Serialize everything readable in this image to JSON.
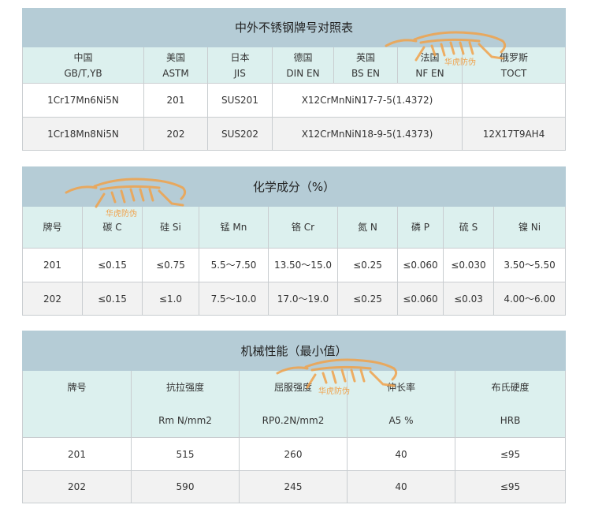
{
  "table1": {
    "title": "中外不锈钢牌号对照表",
    "headers": [
      {
        "line1": "中国",
        "line2": "GB/T,YB"
      },
      {
        "line1": "美国",
        "line2": "ASTM"
      },
      {
        "line1": "日本",
        "line2": "JIS"
      },
      {
        "line1": "德国",
        "line2": "DIN EN"
      },
      {
        "line1": "英国",
        "line2": "BS EN"
      },
      {
        "line1": "法国",
        "line2": "NF EN"
      },
      {
        "line1": "俄罗斯",
        "line2": "TOCT"
      }
    ],
    "rows": [
      {
        "cn": "1Cr17Mn6Ni5N",
        "us": "201",
        "jp": "SUS201",
        "eu": "X12CrMnNiN17-7-5(1.4372)",
        "ru": ""
      },
      {
        "cn": "1Cr18Mn8Ni5N",
        "us": "202",
        "jp": "SUS202",
        "eu": "X12CrMnNiN18-9-5(1.4373)",
        "ru": "12X17T9AH4"
      }
    ]
  },
  "table2": {
    "title": "化学成分（%）",
    "headers": [
      "牌号",
      "碳 C",
      "硅 Si",
      "锰 Mn",
      "铬 Cr",
      "氮 N",
      "磷 P",
      "硫 S",
      "镍 Ni"
    ],
    "rows": [
      [
        "201",
        "≤0.15",
        "≤0.75",
        "5.5～7.50",
        "13.50～15.0",
        "≤0.25",
        "≤0.060",
        "≤0.030",
        "3.50～5.50"
      ],
      [
        "202",
        "≤0.15",
        "≤1.0",
        "7.5～10.0",
        "17.0～19.0",
        "≤0.25",
        "≤0.060",
        "≤0.03",
        "4.00～6.00"
      ]
    ]
  },
  "table3": {
    "title": "机械性能（最小值）",
    "headers": [
      {
        "line1": "牌号",
        "line2": ""
      },
      {
        "line1": "抗拉强度",
        "line2": "Rm N/mm2"
      },
      {
        "line1": "屈服强度",
        "line2": "RP0.2N/mm2"
      },
      {
        "line1": "伸长率",
        "line2": "A5 %"
      },
      {
        "line1": "布氏硬度",
        "line2": "HRB"
      }
    ],
    "rows": [
      [
        "201",
        "515",
        "260",
        "40",
        "≤95"
      ],
      [
        "202",
        "590",
        "245",
        "40",
        "≤95"
      ]
    ]
  },
  "watermark": {
    "text": "华虎防伪",
    "color": "#f0a24b"
  }
}
